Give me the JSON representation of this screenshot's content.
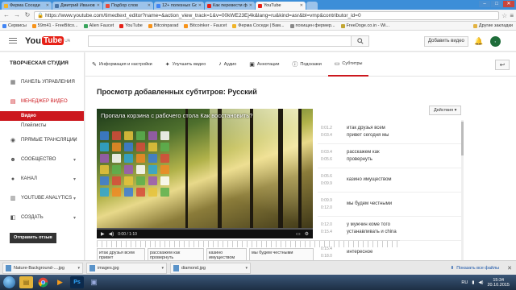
{
  "browser": {
    "tabs": [
      {
        "label": "Ферма Соседи",
        "color": "#f0b429",
        "active": false
      },
      {
        "label": "Дмитрий Иванов",
        "color": "#4a76a8",
        "active": false
      },
      {
        "label": "Подбор слов",
        "color": "#e94b3c",
        "active": false
      },
      {
        "label": "12+ полезных Google C",
        "color": "#4285f4",
        "active": false
      },
      {
        "label": "Как перевести фотогра",
        "color": "#e62117",
        "active": false
      },
      {
        "label": "YouTube",
        "color": "#e62117",
        "active": true
      }
    ],
    "url": "https://www.youtube.com/timedtext_editor?name=&action_view_track=1&v=00kWE23Ej4k&lang=ru&kind=asr&bl=vmp&contributor_id=0",
    "bookmarks": [
      {
        "label": "Сервисы",
        "color": "#4285f4"
      },
      {
        "label": "59m41 - FreeBitco...",
        "color": "#f7931a"
      },
      {
        "label": "Alien Faucet",
        "color": "#3aa55d"
      },
      {
        "label": "YouTube",
        "color": "#e62117"
      },
      {
        "label": "Bitcoinparad",
        "color": "#f7931a"
      },
      {
        "label": "Bitcoinker - Faucet",
        "color": "#f7931a"
      },
      {
        "label": "Ферма Соседи | Вам...",
        "color": "#f0b429"
      },
      {
        "label": "похищен фермер...",
        "color": "#888888"
      },
      {
        "label": "FreeDoge.co.in - Wi...",
        "color": "#c2a633"
      }
    ],
    "other_bookmarks": "Другие закладки"
  },
  "youtube": {
    "logo_you": "You",
    "logo_tube": "Tube",
    "logo_region": "UA",
    "add_video": "Добавить видео"
  },
  "sidebar": {
    "heading": "ТВОРЧЕСКАЯ СТУДИЯ",
    "items": [
      {
        "label": "ПАНЕЛЬ УПРАВЛЕНИЯ",
        "icon": "▦",
        "chevron": false,
        "active": false
      },
      {
        "label": "МЕНЕДЖЕР ВИДЕО",
        "icon": "▤",
        "chevron": false,
        "active": true
      },
      {
        "label": "ПРЯМЫЕ ТРАНСЛЯЦИИ",
        "icon": "◉",
        "chevron": true,
        "active": false
      },
      {
        "label": "СООБЩЕСТВО",
        "icon": "☻",
        "chevron": true,
        "active": false
      },
      {
        "label": "КАНАЛ",
        "icon": "●",
        "chevron": true,
        "active": false
      },
      {
        "label": "YOUTUBE ANALYTICS",
        "icon": "▥",
        "chevron": true,
        "active": false
      },
      {
        "label": "СОЗДАТЬ",
        "icon": "◧",
        "chevron": true,
        "active": false
      }
    ],
    "subitems": [
      {
        "label": "Видео",
        "selected": true
      },
      {
        "label": "Плейлисты",
        "selected": false
      }
    ],
    "feedback": "Отправить отзыв"
  },
  "toptabs": [
    {
      "label": "Информация и настройки",
      "icon": "✎",
      "active": false
    },
    {
      "label": "Улучшить видео",
      "icon": "✦",
      "active": false
    },
    {
      "label": "Аудио",
      "icon": "♪",
      "active": false
    },
    {
      "label": "Аннотации",
      "icon": "▣",
      "active": false
    },
    {
      "label": "Подсказки",
      "icon": "ⓘ",
      "active": false
    },
    {
      "label": "Субтитры",
      "icon": "▭",
      "active": true
    }
  ],
  "page_title": "Просмотр добавленных субтитров: Русский",
  "video": {
    "title": "Пропала корзина с рабочего стола Как восстановить?",
    "time": "0:00 / 1:10",
    "progress_fraction": 0.0
  },
  "actions_label": "Действия ▾",
  "subtitles": [
    {
      "start": "0:01.2",
      "end": "0:03.4",
      "text": [
        "итак друзья всем",
        "привет сегодня мы"
      ]
    },
    {
      "start": "0:03.4",
      "end": "0:05.6",
      "text": [
        "расскажем как",
        "провернуть"
      ]
    },
    {
      "start": "0:05.6",
      "end": "0:09.9",
      "text": [
        "казино имуществом"
      ]
    },
    {
      "start": "0:09.9",
      "end": "0:12.0",
      "text": [
        "мы будем честными"
      ]
    },
    {
      "start": "0:12.0",
      "end": "0:15.4",
      "text": [
        "у мужчин коме того",
        "устанавливать и china"
      ]
    },
    {
      "start": "0:15.4",
      "end": "0:18.0",
      "text": [
        "интересное"
      ]
    }
  ],
  "timeline_cues": [
    "итак друзья всем привет",
    "расскажем как провернуть",
    "казино имуществом",
    "мы будем честными"
  ],
  "downloads": {
    "files": [
      "Nature-Background-....jpg",
      "images.jpg",
      "diamond.jpg"
    ],
    "show_all": "Показать все файлы"
  },
  "taskbar": {
    "time": "15:34",
    "date": "20.10.2015",
    "lang": "RU"
  }
}
